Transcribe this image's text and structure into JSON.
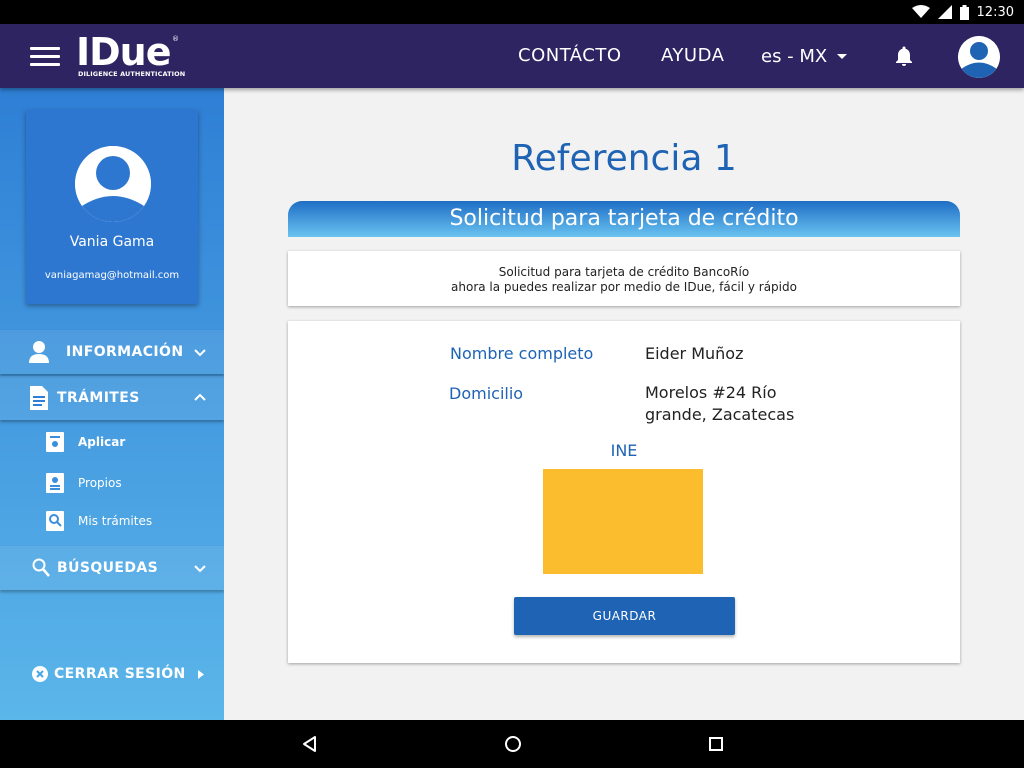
{
  "status_bar": {
    "time": "12:30"
  },
  "app_bar": {
    "logo_text": "IDue",
    "logo_tagline": "DILIGENCE AUTHENTICATION",
    "logo_reg": "®",
    "nav": [
      {
        "label": "CONTÁCTO"
      },
      {
        "label": "AYUDA"
      }
    ],
    "language": "es - MX"
  },
  "sidebar": {
    "profile": {
      "name": "Vania Gama",
      "email": "vaniagamag@hotmail.com"
    },
    "sections": [
      {
        "label": "INFORMACIÓN",
        "expanded": false
      },
      {
        "label": "TRÁMITES",
        "expanded": true
      },
      {
        "label": "BÚSQUEDAS",
        "expanded": false
      }
    ],
    "tramites_items": [
      {
        "label": "Aplicar",
        "active": true
      },
      {
        "label": "Propios",
        "active": false
      },
      {
        "label": "Mis trámites",
        "active": false
      }
    ],
    "logout": "CERRAR SESIÓN"
  },
  "main": {
    "title": "Referencia 1",
    "banner": "Solicitud para tarjeta de crédito",
    "info_line1": "Solicitud para tarjeta de crédito BancoRío",
    "info_line2": "ahora la puedes realizar por medio de IDue, fácil y rápido",
    "form": {
      "name_label": "Nombre completo",
      "name_value": "Eider Muñoz",
      "address_label": "Domicilio",
      "address_line1": "Morelos #24  Río",
      "address_line2": "grande, Zacatecas",
      "ine_label": "INE",
      "save_label": "GUARDAR"
    }
  },
  "colors": {
    "app_bar": "#2d2461",
    "accent_blue": "#1f63b5",
    "ine_placeholder": "#fbbd2d"
  }
}
